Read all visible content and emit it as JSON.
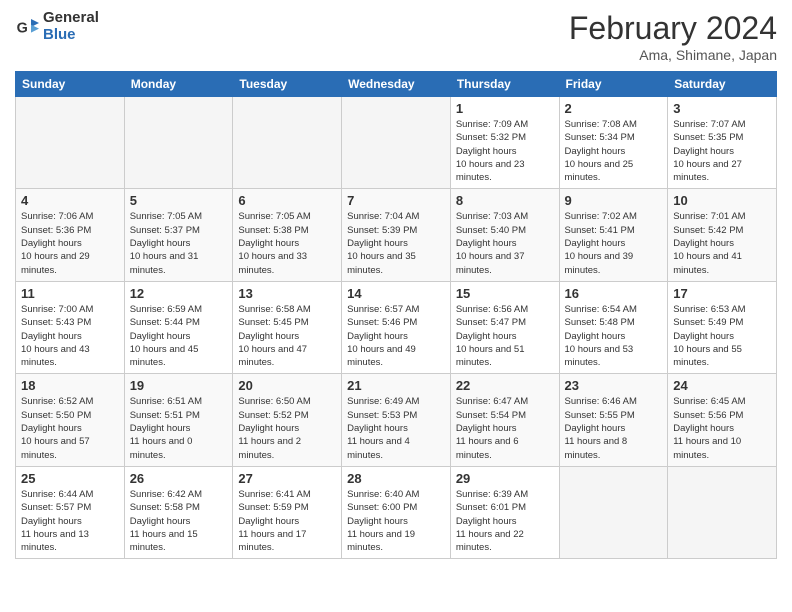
{
  "app": {
    "name_general": "General",
    "name_blue": "Blue"
  },
  "header": {
    "month": "February 2024",
    "location": "Ama, Shimane, Japan"
  },
  "weekdays": [
    "Sunday",
    "Monday",
    "Tuesday",
    "Wednesday",
    "Thursday",
    "Friday",
    "Saturday"
  ],
  "weeks": [
    [
      {
        "day": "",
        "empty": true
      },
      {
        "day": "",
        "empty": true
      },
      {
        "day": "",
        "empty": true
      },
      {
        "day": "",
        "empty": true
      },
      {
        "day": "1",
        "sunrise": "7:09 AM",
        "sunset": "5:32 PM",
        "daylight": "10 hours and 23 minutes."
      },
      {
        "day": "2",
        "sunrise": "7:08 AM",
        "sunset": "5:34 PM",
        "daylight": "10 hours and 25 minutes."
      },
      {
        "day": "3",
        "sunrise": "7:07 AM",
        "sunset": "5:35 PM",
        "daylight": "10 hours and 27 minutes."
      }
    ],
    [
      {
        "day": "4",
        "sunrise": "7:06 AM",
        "sunset": "5:36 PM",
        "daylight": "10 hours and 29 minutes."
      },
      {
        "day": "5",
        "sunrise": "7:05 AM",
        "sunset": "5:37 PM",
        "daylight": "10 hours and 31 minutes."
      },
      {
        "day": "6",
        "sunrise": "7:05 AM",
        "sunset": "5:38 PM",
        "daylight": "10 hours and 33 minutes."
      },
      {
        "day": "7",
        "sunrise": "7:04 AM",
        "sunset": "5:39 PM",
        "daylight": "10 hours and 35 minutes."
      },
      {
        "day": "8",
        "sunrise": "7:03 AM",
        "sunset": "5:40 PM",
        "daylight": "10 hours and 37 minutes."
      },
      {
        "day": "9",
        "sunrise": "7:02 AM",
        "sunset": "5:41 PM",
        "daylight": "10 hours and 39 minutes."
      },
      {
        "day": "10",
        "sunrise": "7:01 AM",
        "sunset": "5:42 PM",
        "daylight": "10 hours and 41 minutes."
      }
    ],
    [
      {
        "day": "11",
        "sunrise": "7:00 AM",
        "sunset": "5:43 PM",
        "daylight": "10 hours and 43 minutes."
      },
      {
        "day": "12",
        "sunrise": "6:59 AM",
        "sunset": "5:44 PM",
        "daylight": "10 hours and 45 minutes."
      },
      {
        "day": "13",
        "sunrise": "6:58 AM",
        "sunset": "5:45 PM",
        "daylight": "10 hours and 47 minutes."
      },
      {
        "day": "14",
        "sunrise": "6:57 AM",
        "sunset": "5:46 PM",
        "daylight": "10 hours and 49 minutes."
      },
      {
        "day": "15",
        "sunrise": "6:56 AM",
        "sunset": "5:47 PM",
        "daylight": "10 hours and 51 minutes."
      },
      {
        "day": "16",
        "sunrise": "6:54 AM",
        "sunset": "5:48 PM",
        "daylight": "10 hours and 53 minutes."
      },
      {
        "day": "17",
        "sunrise": "6:53 AM",
        "sunset": "5:49 PM",
        "daylight": "10 hours and 55 minutes."
      }
    ],
    [
      {
        "day": "18",
        "sunrise": "6:52 AM",
        "sunset": "5:50 PM",
        "daylight": "10 hours and 57 minutes."
      },
      {
        "day": "19",
        "sunrise": "6:51 AM",
        "sunset": "5:51 PM",
        "daylight": "11 hours and 0 minutes."
      },
      {
        "day": "20",
        "sunrise": "6:50 AM",
        "sunset": "5:52 PM",
        "daylight": "11 hours and 2 minutes."
      },
      {
        "day": "21",
        "sunrise": "6:49 AM",
        "sunset": "5:53 PM",
        "daylight": "11 hours and 4 minutes."
      },
      {
        "day": "22",
        "sunrise": "6:47 AM",
        "sunset": "5:54 PM",
        "daylight": "11 hours and 6 minutes."
      },
      {
        "day": "23",
        "sunrise": "6:46 AM",
        "sunset": "5:55 PM",
        "daylight": "11 hours and 8 minutes."
      },
      {
        "day": "24",
        "sunrise": "6:45 AM",
        "sunset": "5:56 PM",
        "daylight": "11 hours and 10 minutes."
      }
    ],
    [
      {
        "day": "25",
        "sunrise": "6:44 AM",
        "sunset": "5:57 PM",
        "daylight": "11 hours and 13 minutes."
      },
      {
        "day": "26",
        "sunrise": "6:42 AM",
        "sunset": "5:58 PM",
        "daylight": "11 hours and 15 minutes."
      },
      {
        "day": "27",
        "sunrise": "6:41 AM",
        "sunset": "5:59 PM",
        "daylight": "11 hours and 17 minutes."
      },
      {
        "day": "28",
        "sunrise": "6:40 AM",
        "sunset": "6:00 PM",
        "daylight": "11 hours and 19 minutes."
      },
      {
        "day": "29",
        "sunrise": "6:39 AM",
        "sunset": "6:01 PM",
        "daylight": "11 hours and 22 minutes."
      },
      {
        "day": "",
        "empty": true
      },
      {
        "day": "",
        "empty": true
      }
    ]
  ],
  "labels": {
    "sunrise": "Sunrise:",
    "sunset": "Sunset:",
    "daylight": "Daylight:"
  }
}
